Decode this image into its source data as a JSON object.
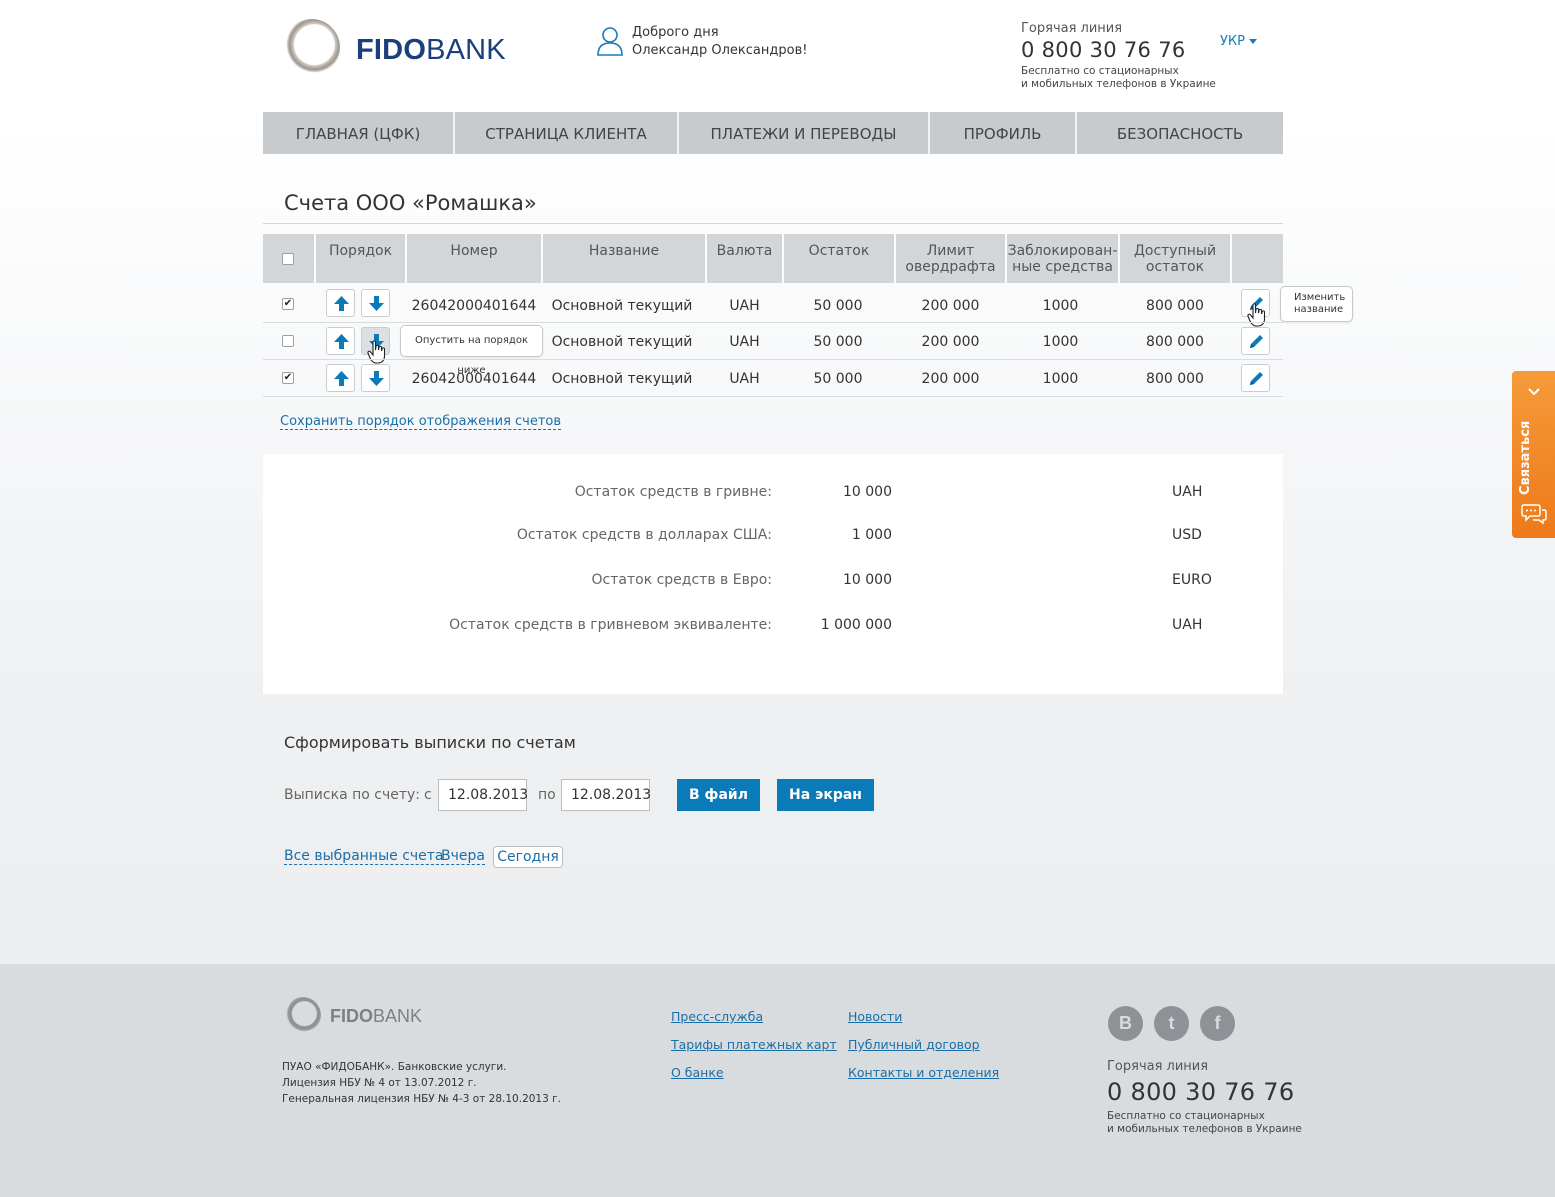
{
  "header": {
    "logo_bold": "FIDO",
    "logo_light": "BANK",
    "greeting_line1": "Доброго дня",
    "greeting_line2": "Олександр Олександров!",
    "hotline_label": "Горячая линия",
    "hotline_phone": "0 800 30 76 76",
    "hotline_note_1": "Бесплатно со стационарных",
    "hotline_note_2": "и мобильных телефонов в Украине",
    "language": "УКР"
  },
  "nav": {
    "items": [
      {
        "label": "ГЛАВНАЯ (ЦФК)"
      },
      {
        "label": "СТРАНИЦА КЛИЕНТА"
      },
      {
        "label": "ПЛАТЕЖИ И ПЕРЕВОДЫ"
      },
      {
        "label": "ПРОФИЛЬ"
      },
      {
        "label": "БЕЗОПАСНОСТЬ"
      }
    ]
  },
  "page_title": "Счета ООО «Ромашка»",
  "table": {
    "headers": {
      "order": "Порядок",
      "number": "Номер",
      "name": "Название",
      "currency": "Валюта",
      "balance": "Остаток",
      "overdraft_1": "Лимит",
      "overdraft_2": "овердрафта",
      "blocked_1": "Заблокирован-",
      "blocked_2": "ные средства",
      "available_1": "Доступный",
      "available_2": "остаток"
    },
    "rows": [
      {
        "checked": "✔",
        "number": "26042000401644",
        "name": "Основной текущий",
        "currency": "UAH",
        "balance": "50 000",
        "overdraft": "200 000",
        "blocked": "1000",
        "available": "800 000"
      },
      {
        "checked": "",
        "number": "",
        "name": "Основной текущий",
        "currency": "UAH",
        "balance": "50 000",
        "overdraft": "200 000",
        "blocked": "1000",
        "available": "800 000"
      },
      {
        "checked": "✔",
        "number": "26042000401644",
        "name": "Основной текущий",
        "currency": "UAH",
        "balance": "50 000",
        "overdraft": "200 000",
        "blocked": "1000",
        "available": "800 000"
      }
    ],
    "tooltip_move_down": "Опустить на порядок ниже",
    "tooltip_rename_1": "Изменить",
    "tooltip_rename_2": "название"
  },
  "save_order_link": "Сохранить порядок отображения счетов",
  "balances": [
    {
      "label": "Остаток средств в гривне:",
      "value": "10 000",
      "currency": "UAH"
    },
    {
      "label": "Остаток средств в долларах США:",
      "value": "1 000",
      "currency": "USD"
    },
    {
      "label": "Остаток средств в Евро:",
      "value": "10 000",
      "currency": "EURO"
    },
    {
      "label": "Остаток средств в гривневом эквиваленте:",
      "value": "1 000 000",
      "currency": "UAH"
    }
  ],
  "statements": {
    "title": "Сформировать выписки по счетам",
    "label": "Выписка по счету:",
    "from_label": "с",
    "from_value": "12.08.2013",
    "to_label": "по",
    "to_value": "12.08.2013",
    "to_file_button": "В файл",
    "to_screen_button": "На экран",
    "all_selected_link": "Все выбранные счета",
    "yesterday_link": "Вчера",
    "today_link": "Сегодня"
  },
  "side_tab": {
    "label": "Связаться"
  },
  "footer": {
    "logo_bold": "FIDO",
    "logo_light": "BANK",
    "legal_1": "ПУАО «ФИДОБАНК». Банковские услуги.",
    "legal_2": "Лицензия НБУ № 4 от 13.07.2012 г.",
    "legal_3": "Генеральная лицензия НБУ № 4-3 от 28.10.2013 г.",
    "links_col1": [
      "Пресс-служба",
      "Тарифы платежных карт",
      "О банке"
    ],
    "links_col2": [
      "Новости",
      "Публичный договор",
      "Контакты и отделения"
    ],
    "social": [
      "В",
      "t",
      "f"
    ],
    "hotline_label": "Горячая линия",
    "hotline_phone": "0 800 30 76 76",
    "hotline_note_1": "Бесплатно со стационарных",
    "hotline_note_2": "и мобильных телефонов в Украине"
  },
  "colors": {
    "brand_blue": "#0b7ab8",
    "link_blue": "#1a6ea8",
    "logo_navy": "#1a3f7a",
    "contact_orange": "#ee7a1a",
    "nav_gray": "#c7cbce"
  }
}
